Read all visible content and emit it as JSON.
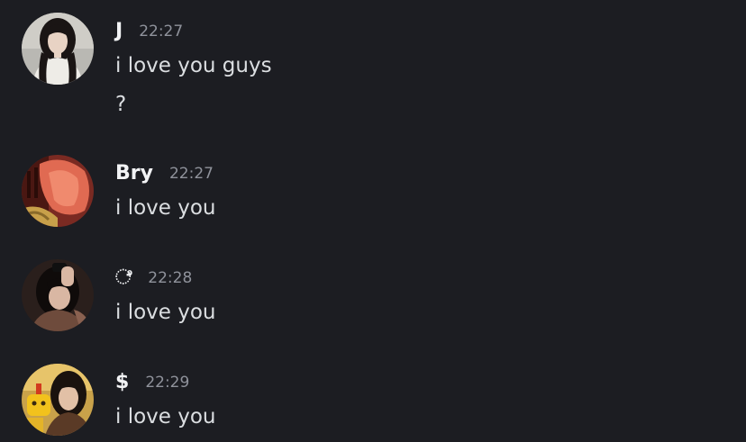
{
  "colors": {
    "background": "#1c1d22",
    "username": "#f2f3f5",
    "timestamp": "#8f929b",
    "message_text": "#dbdee1"
  },
  "messages": [
    {
      "username": "J",
      "time": "22:27",
      "lines": [
        "i love you guys",
        "?"
      ],
      "avatar": "user-avatar-photo"
    },
    {
      "username": "Bry",
      "time": "22:27",
      "lines": [
        "i love you"
      ],
      "avatar": "user-avatar-photo"
    },
    {
      "username": "ೆ",
      "time": "22:28",
      "lines": [
        "i love you"
      ],
      "avatar": "user-avatar-photo"
    },
    {
      "username": "$",
      "time": "22:29",
      "lines": [
        "i love you"
      ],
      "avatar": "user-avatar-photo"
    }
  ]
}
